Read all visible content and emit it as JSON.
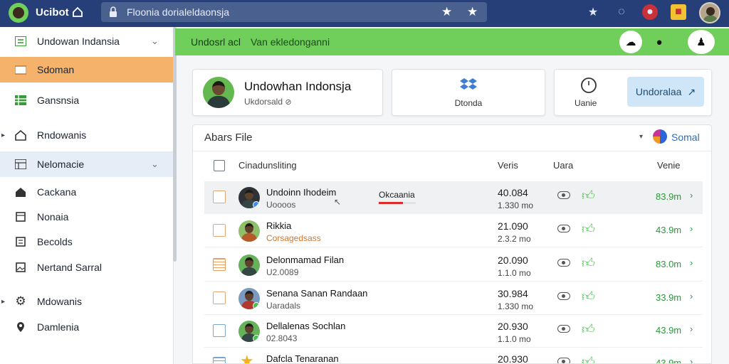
{
  "topbar": {
    "app_title": "Ucibot",
    "address": "Floonia dorialeldaonsja"
  },
  "sidebar": {
    "items": [
      {
        "label": "Undowan Indansia",
        "icon": "list-icon"
      },
      {
        "label": "Sdoman",
        "icon": "folder-icon",
        "active": true
      },
      {
        "label": "Gansnsia",
        "icon": "grid-icon"
      },
      {
        "label": "Rndowanis",
        "icon": "home-icon"
      },
      {
        "label": "Nelomacie",
        "icon": "table-icon"
      },
      {
        "label": "Cackana",
        "icon": "home-icon"
      },
      {
        "label": "Nonaia",
        "icon": "document-icon"
      },
      {
        "label": "Becolds",
        "icon": "list-icon"
      },
      {
        "label": "Nertand Sarral",
        "icon": "image-icon"
      },
      {
        "label": "Mdowanis",
        "icon": "gear-icon"
      },
      {
        "label": "Damlenia",
        "icon": "location-icon"
      }
    ]
  },
  "header": {
    "title": "Undosrl acl",
    "subtitle": "Van ekledonganni"
  },
  "cards": {
    "profile_name": "Undowhan Indonsja",
    "profile_sub": "Ukdorsald",
    "card2_label": "Dtonda",
    "card3_label": "Uanie",
    "upload_label": "Undoralaa"
  },
  "panel": {
    "title": "Abars File",
    "sort_label": "Somal",
    "columns": {
      "name": "Cinadunsliting",
      "version": "Veris",
      "users": "Uara",
      "value": "Venie"
    }
  },
  "rows": [
    {
      "name": "Undoinn Ihodeim",
      "sub": "Uoooos",
      "tag": "Okcaania",
      "tag_progress": 0.65,
      "v1": "40.084",
      "v2": "1.330 mo",
      "amount": "83.9m"
    },
    {
      "name": "Rikkia",
      "sub": "Corsagedsass",
      "v1": "21.090",
      "v2": "2.3.2 mo",
      "amount": "43.9m"
    },
    {
      "name": "Delonmamad Filan",
      "sub": "U2.0089",
      "v1": "20.090",
      "v2": "1.1.0 mo",
      "amount": "83.0m"
    },
    {
      "name": "Senana Sanan Randaan",
      "sub": "Uaradals",
      "v1": "30.984",
      "v2": "1.330 mo",
      "amount": "33.9m"
    },
    {
      "name": "Dellalenas Sochlan",
      "sub": "02.8043",
      "v1": "20.930",
      "v2": "1.1.0 mo",
      "amount": "43.9m"
    },
    {
      "name": "Dafcla Tenaranan",
      "sub": "",
      "v1": "20.930",
      "v2": "",
      "amount": "43.9m"
    }
  ]
}
